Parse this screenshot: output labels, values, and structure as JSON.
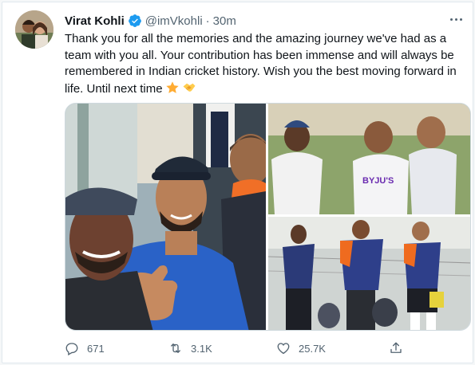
{
  "tweet": {
    "author_name": "Virat Kohli",
    "handle": "@imVkohli",
    "separator": "·",
    "time": "30m",
    "text": "Thank you for all the memories and the amazing journey we've had as a team with you all. Your contribution has been immense and will always be remembered in Indian cricket history. Wish you the best moving forward in life. Until next time",
    "emojis": [
      "star-emoji",
      "handshake-emoji"
    ]
  },
  "media": {
    "jersey_brand": "BYJU'S"
  },
  "actions": {
    "replies": "671",
    "retweets": "3.1K",
    "likes": "25.7K"
  },
  "colors": {
    "verified": "#1d9bf0",
    "muted": "#536471",
    "text": "#0f1419"
  }
}
